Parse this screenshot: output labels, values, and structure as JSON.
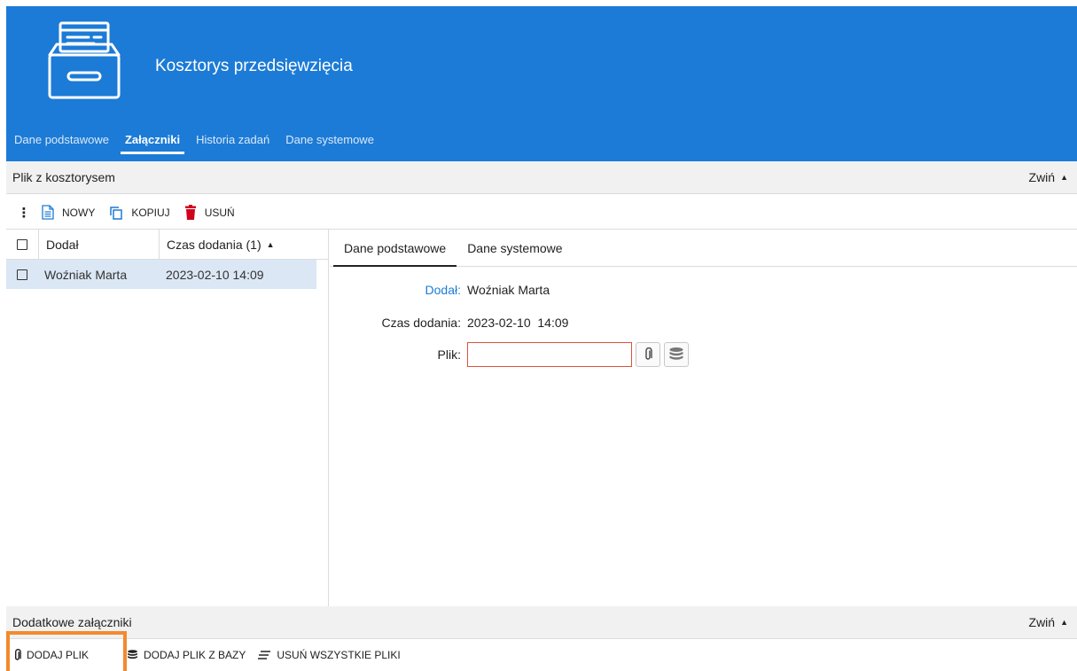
{
  "header": {
    "title": "Kosztorys przedsięwzięcia",
    "logo_icon": "file-cabinet-icon",
    "bg_color": "#1c7bd6"
  },
  "nav": {
    "tabs": [
      {
        "label": "Dane podstawowe",
        "active": false
      },
      {
        "label": "Załączniki",
        "active": true
      },
      {
        "label": "Historia zadań",
        "active": false
      },
      {
        "label": "Dane systemowe",
        "active": false
      }
    ]
  },
  "section1": {
    "title": "Plik z kosztorysem",
    "collapse_label": "Zwiń",
    "toolbar": {
      "new_label": "NOWY",
      "copy_label": "KOPIUJ",
      "delete_label": "USUŃ"
    },
    "list": {
      "columns": [
        "Dodał",
        "Czas dodania (1)"
      ],
      "rows": [
        {
          "dodal": "Woźniak Marta",
          "czas": "2023-02-10 14:09",
          "selected": true
        }
      ]
    },
    "detail": {
      "tabs": [
        {
          "label": "Dane podstawowe",
          "active": true
        },
        {
          "label": "Dane systemowe",
          "active": false
        }
      ],
      "fields": {
        "dodal_label": "Dodał:",
        "dodal_value": "Woźniak Marta",
        "czas_label": "Czas dodania:",
        "czas_value": "2023-02-10  14:09",
        "plik_label": "Plik:",
        "plik_value": ""
      }
    }
  },
  "section2": {
    "title": "Dodatkowe załączniki",
    "collapse_label": "Zwiń",
    "toolbar": {
      "add_file_label": "DODAJ PLIK",
      "add_from_db_label": "DODAJ PLIK Z BAZY",
      "remove_all_label": "USUŃ WSZYSTKIE PLIKI"
    }
  },
  "colors": {
    "accent": "#1c7bd6",
    "delete_red": "#d0021b",
    "highlight_orange": "#f28a2e",
    "selected_row": "#dbe7f4",
    "error_border": "#d9533b"
  }
}
